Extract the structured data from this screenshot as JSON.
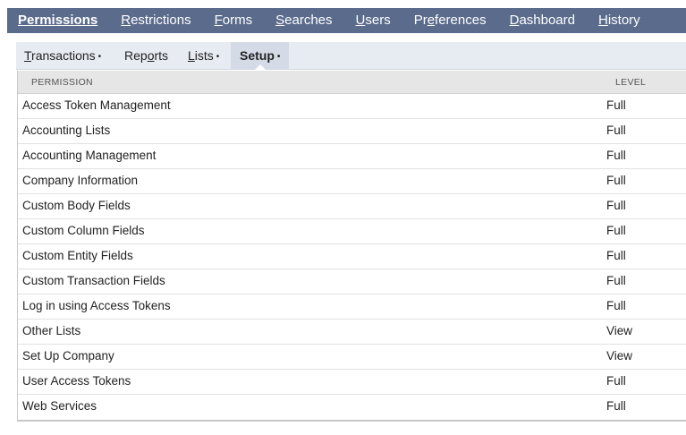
{
  "main_tabs": [
    {
      "label_first": "P",
      "label_rest": "ermissions",
      "active": true
    },
    {
      "label_first": "R",
      "label_rest": "estrictions",
      "active": false
    },
    {
      "label_first": "F",
      "label_rest": "orms",
      "active": false
    },
    {
      "label_first": "S",
      "label_rest": "earches",
      "active": false
    },
    {
      "label_first": "U",
      "label_rest": "sers",
      "active": false
    },
    {
      "label_first": "Pr",
      "label_mid": "e",
      "label_rest": "ferences",
      "active": false
    },
    {
      "label_first": "D",
      "label_rest": "ashboard",
      "active": false
    },
    {
      "label_first": "H",
      "label_rest": "istory",
      "active": false
    }
  ],
  "sub_tabs": {
    "transactions": {
      "u": "T",
      "rest": "ransactions",
      "dot": "•"
    },
    "reports": {
      "pre": "Rep",
      "u": "o",
      "rest": "rts"
    },
    "lists": {
      "u": "L",
      "rest": "ists",
      "dot": "•"
    },
    "setup": {
      "label": "Setup",
      "dot": "•"
    }
  },
  "table": {
    "headers": {
      "permission": "PERMISSION",
      "level": "LEVEL"
    },
    "rows": [
      {
        "permission": "Access Token Management",
        "level": "Full"
      },
      {
        "permission": "Accounting Lists",
        "level": "Full"
      },
      {
        "permission": "Accounting Management",
        "level": "Full"
      },
      {
        "permission": "Company Information",
        "level": "Full"
      },
      {
        "permission": "Custom Body Fields",
        "level": "Full"
      },
      {
        "permission": "Custom Column Fields",
        "level": "Full"
      },
      {
        "permission": "Custom Entity Fields",
        "level": "Full"
      },
      {
        "permission": "Custom Transaction Fields",
        "level": "Full"
      },
      {
        "permission": "Log in using Access Tokens",
        "level": "Full"
      },
      {
        "permission": "Other Lists",
        "level": "View"
      },
      {
        "permission": "Set Up Company",
        "level": "View"
      },
      {
        "permission": "User Access Tokens",
        "level": "Full"
      },
      {
        "permission": "Web Services",
        "level": "Full"
      }
    ]
  }
}
